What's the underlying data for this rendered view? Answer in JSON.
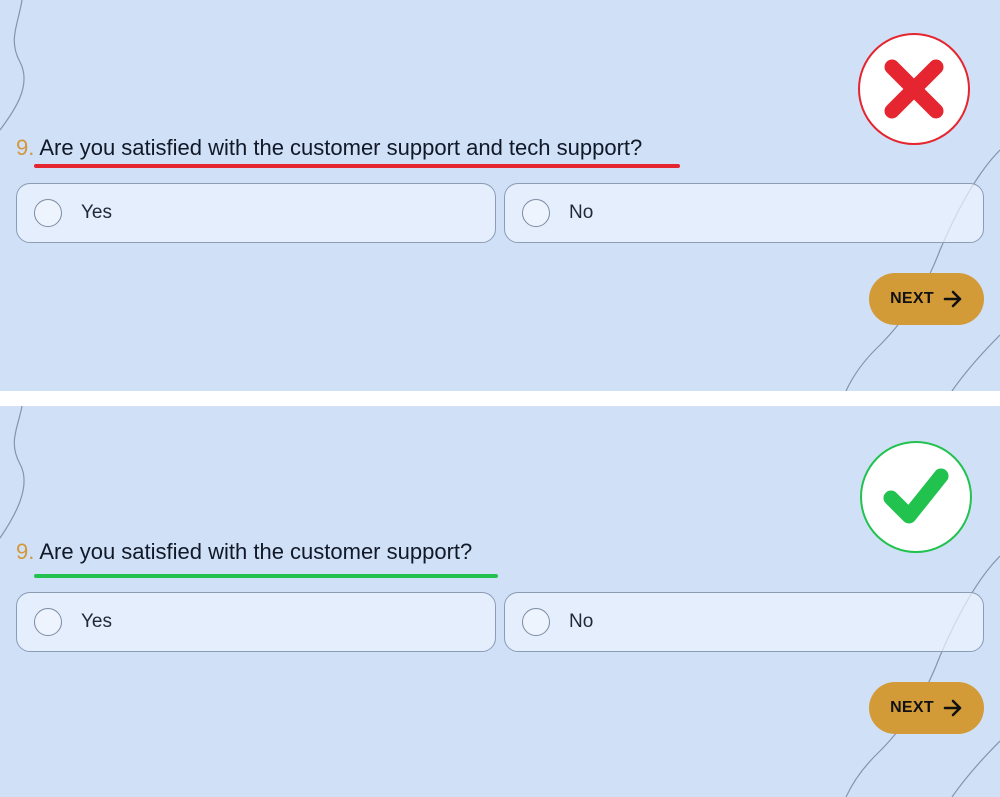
{
  "colors": {
    "background": "#cfe0f7",
    "accent_number": "#d4973a",
    "next_button": "#d39b37",
    "incorrect": "#e5252f",
    "correct": "#22c24f"
  },
  "examples": [
    {
      "status": "incorrect",
      "badge_icon": "cross-icon",
      "question_number": "9.",
      "question_text": "Are you satisfied with the customer support and tech support?",
      "options": [
        "Yes",
        "No"
      ],
      "next_label": "NEXT",
      "next_icon": "arrow-right-icon"
    },
    {
      "status": "correct",
      "badge_icon": "checkmark-icon",
      "question_number": "9.",
      "question_text": "Are you satisfied with the customer support?",
      "options": [
        "Yes",
        "No"
      ],
      "next_label": "NEXT",
      "next_icon": "arrow-right-icon"
    }
  ]
}
